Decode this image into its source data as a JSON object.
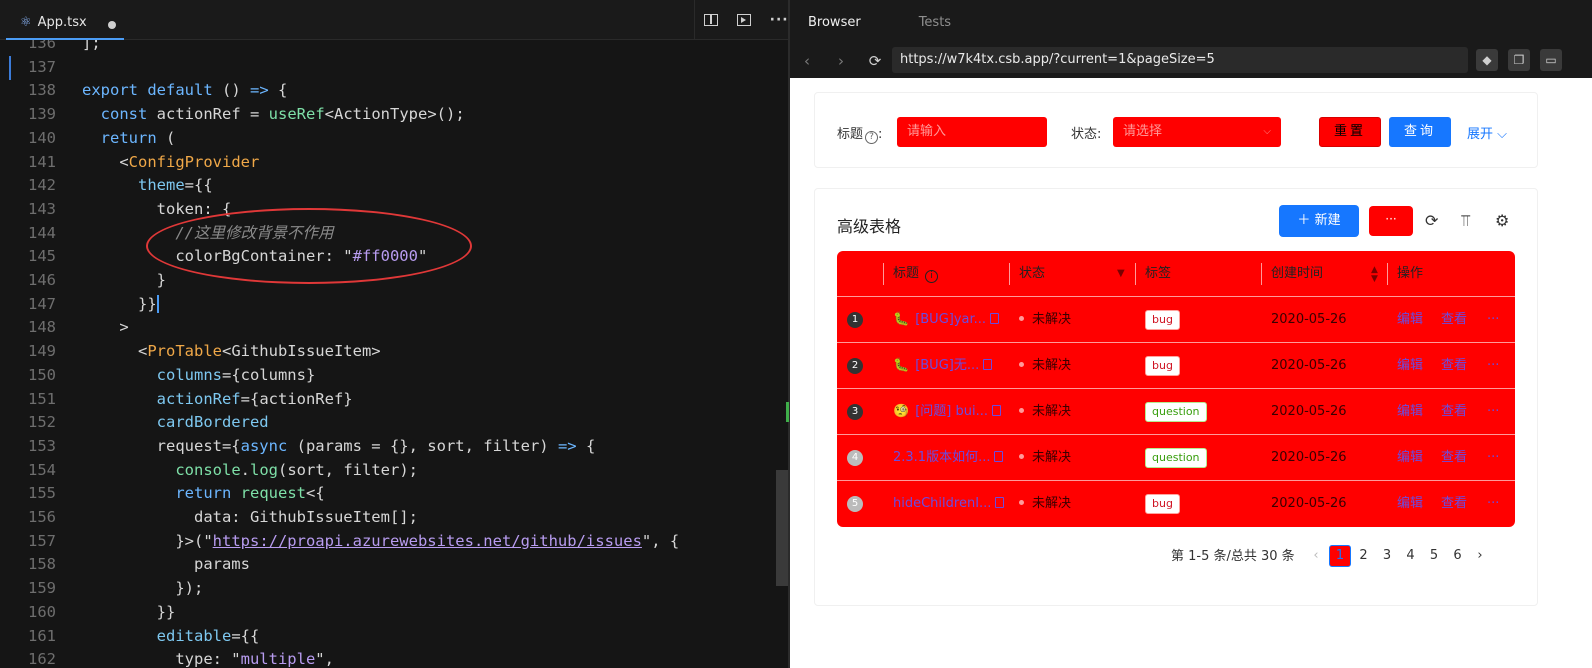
{
  "editor": {
    "tab_name": "App.tsx",
    "tab_icon": "react-icon",
    "line_numbers": [
      "136",
      "137",
      "138",
      "139",
      "140",
      "141",
      "142",
      "143",
      "144",
      "145",
      "146",
      "147",
      "148",
      "149",
      "150",
      "151",
      "152",
      "153",
      "154",
      "155",
      "156",
      "157",
      "158",
      "159",
      "160",
      "161",
      "162"
    ],
    "code_lines": [
      "];",
      "",
      "export default () => {",
      "  const actionRef = useRef<ActionType>();",
      "  return (",
      "    <ConfigProvider",
      "      theme={{",
      "        token: {",
      "          //这里修改背景不作用",
      "          colorBgContainer: \"#ff0000\"",
      "        }",
      "      }}",
      "    >",
      "      <ProTable<GithubIssueItem>",
      "        columns={columns}",
      "        actionRef={actionRef}",
      "        cardBordered",
      "        request={async (params = {}, sort, filter) => {",
      "          console.log(sort, filter);",
      "          return request<{",
      "            data: GithubIssueItem[];",
      "          }>(\"https://proapi.azurewebsites.net/github/issues\", {",
      "            params",
      "          });",
      "        }}",
      "        editable={{",
      "          type: \"multiple\","
    ],
    "comment": "//这里修改背景不作用",
    "color_value": "#ff0000",
    "url_literal": "https://proapi.azurewebsites.net/github/issues"
  },
  "browser": {
    "tabs": [
      "Browser",
      "Tests"
    ],
    "url": "https://w7k4tx.csb.app/?current=1&pageSize=5"
  },
  "search": {
    "title_label": "标题",
    "title_placeholder": "请输入",
    "status_label": "状态:",
    "status_placeholder": "请选择",
    "reset_label": "重置",
    "query_label": "查询",
    "expand_label": "展开"
  },
  "table": {
    "title": "高级表格",
    "new_label": "新建",
    "more_label": "···",
    "columns": [
      "标题",
      "状态",
      "标签",
      "创建时间",
      "操作"
    ],
    "rows": [
      {
        "index": "1",
        "title": "[BUG]yar...",
        "status": "未解决",
        "tag": "bug",
        "tag_type": "bug",
        "date": "2020-05-26",
        "edit": "编辑",
        "view": "查看",
        "more": "···",
        "emoji": "🐛"
      },
      {
        "index": "2",
        "title": "[BUG]无...",
        "status": "未解决",
        "tag": "bug",
        "tag_type": "bug",
        "date": "2020-05-26",
        "edit": "编辑",
        "view": "查看",
        "more": "···",
        "emoji": "🐛"
      },
      {
        "index": "3",
        "title": "[问题] bui...",
        "status": "未解决",
        "tag": "question",
        "tag_type": "question",
        "date": "2020-05-26",
        "edit": "编辑",
        "view": "查看",
        "more": "···",
        "emoji": "🧐"
      },
      {
        "index": "4",
        "title": "2.3.1版本如何...",
        "status": "未解决",
        "tag": "question",
        "tag_type": "question",
        "date": "2020-05-26",
        "edit": "编辑",
        "view": "查看",
        "more": "···",
        "emoji": ""
      },
      {
        "index": "5",
        "title": "hideChildrenI...",
        "status": "未解决",
        "tag": "bug",
        "tag_type": "bug",
        "date": "2020-05-26",
        "edit": "编辑",
        "view": "查看",
        "more": "···",
        "emoji": ""
      }
    ]
  },
  "pagination": {
    "summary": "第 1-5 条/总共 30 条",
    "pages": [
      "1",
      "2",
      "3",
      "4",
      "5",
      "6"
    ],
    "current": "1"
  },
  "colors": {
    "accent": "#1677ff",
    "table_bg": "#ff0000",
    "annotation": "#e03838"
  }
}
